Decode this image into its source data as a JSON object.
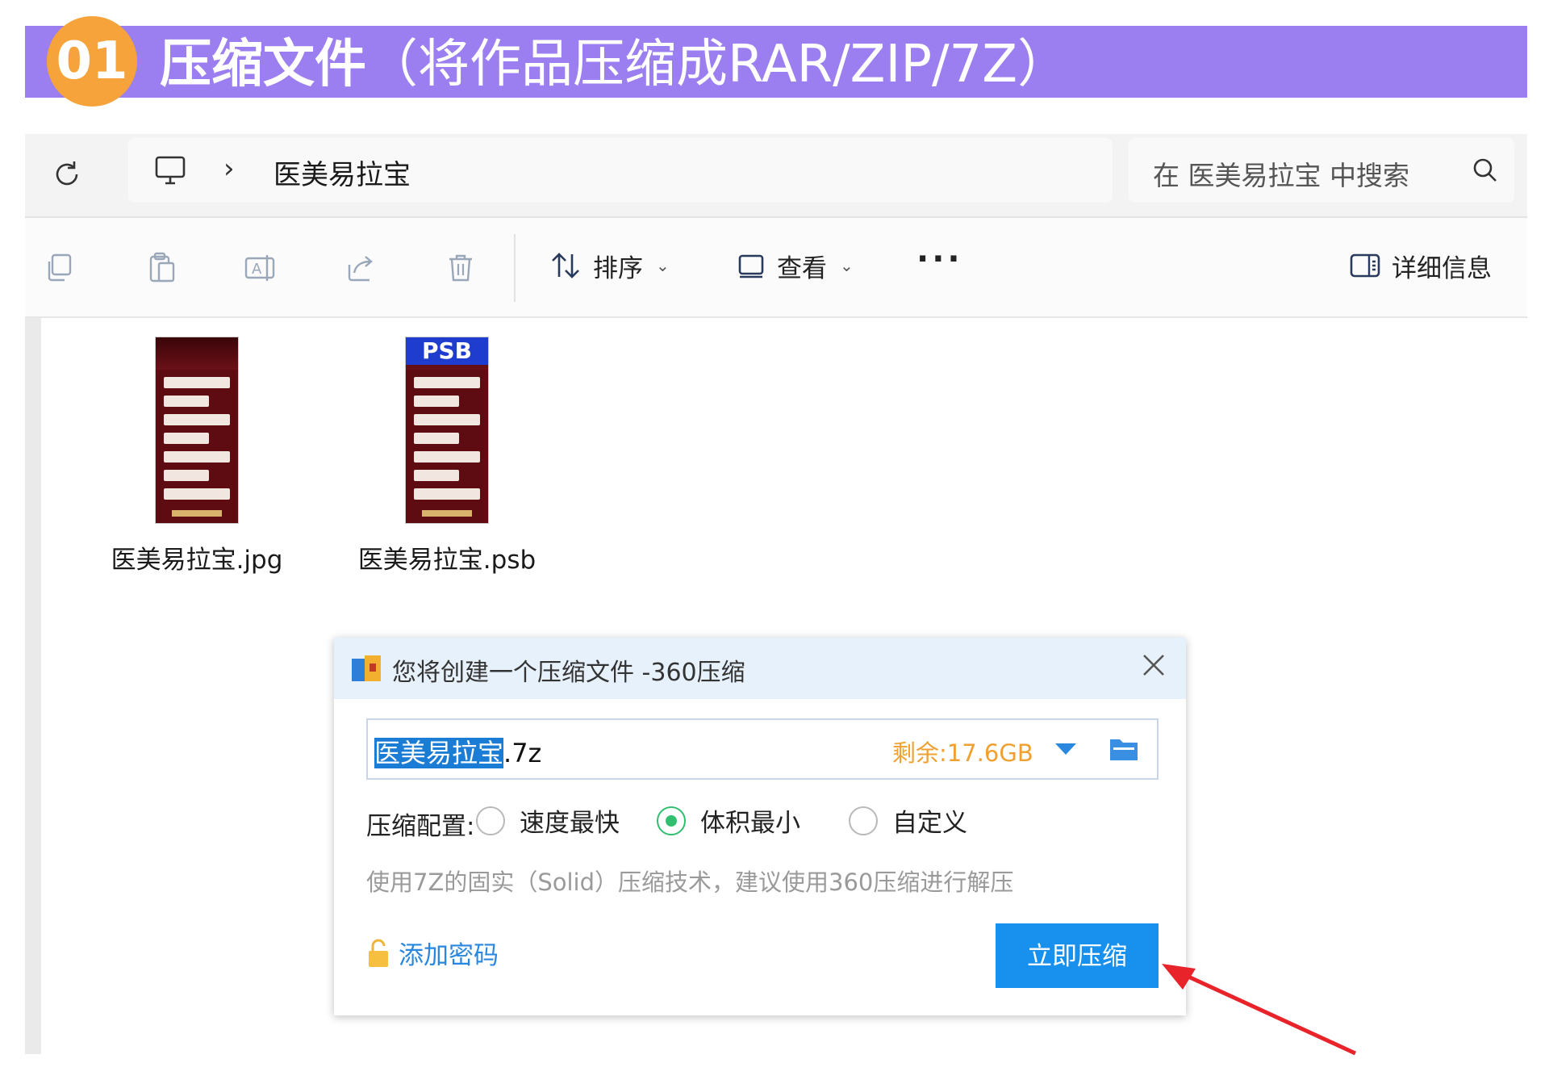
{
  "banner": {
    "step_number": "01",
    "title_bold": "压缩文件",
    "title_rest": "（将作品压缩成RAR/ZIP/7Z）"
  },
  "explorer": {
    "breadcrumb": {
      "folder": "医美易拉宝"
    },
    "search": {
      "placeholder": "在 医美易拉宝 中搜索"
    },
    "toolbar": {
      "sort_label": "排序",
      "view_label": "查看",
      "more_label": "···",
      "details_label": "详细信息"
    },
    "files": [
      {
        "name": "医美易拉宝.jpg"
      },
      {
        "name": "医美易拉宝.psb",
        "badge": "PSB"
      }
    ]
  },
  "dialog": {
    "title": "您将创建一个压缩文件 -360压缩",
    "file_name_selected": "医美易拉宝",
    "file_name_ext": ".7z",
    "free_space": "剩余:17.6GB",
    "config_label": "压缩配置:",
    "options": [
      {
        "label": "速度最快",
        "selected": false
      },
      {
        "label": "体积最小",
        "selected": true
      },
      {
        "label": "自定义",
        "selected": false
      }
    ],
    "hint": "使用7Z的固实（Solid）压缩技术，建议使用360压缩进行解压",
    "add_password": "添加密码",
    "compress_button": "立即压缩"
  },
  "colors": {
    "banner": "#9b7ff0",
    "badge": "#f6a33b",
    "primary_button": "#1891ee",
    "radio_selected": "#2fbf6e",
    "free_space": "#f0a030",
    "arrow": "#e8232a"
  }
}
